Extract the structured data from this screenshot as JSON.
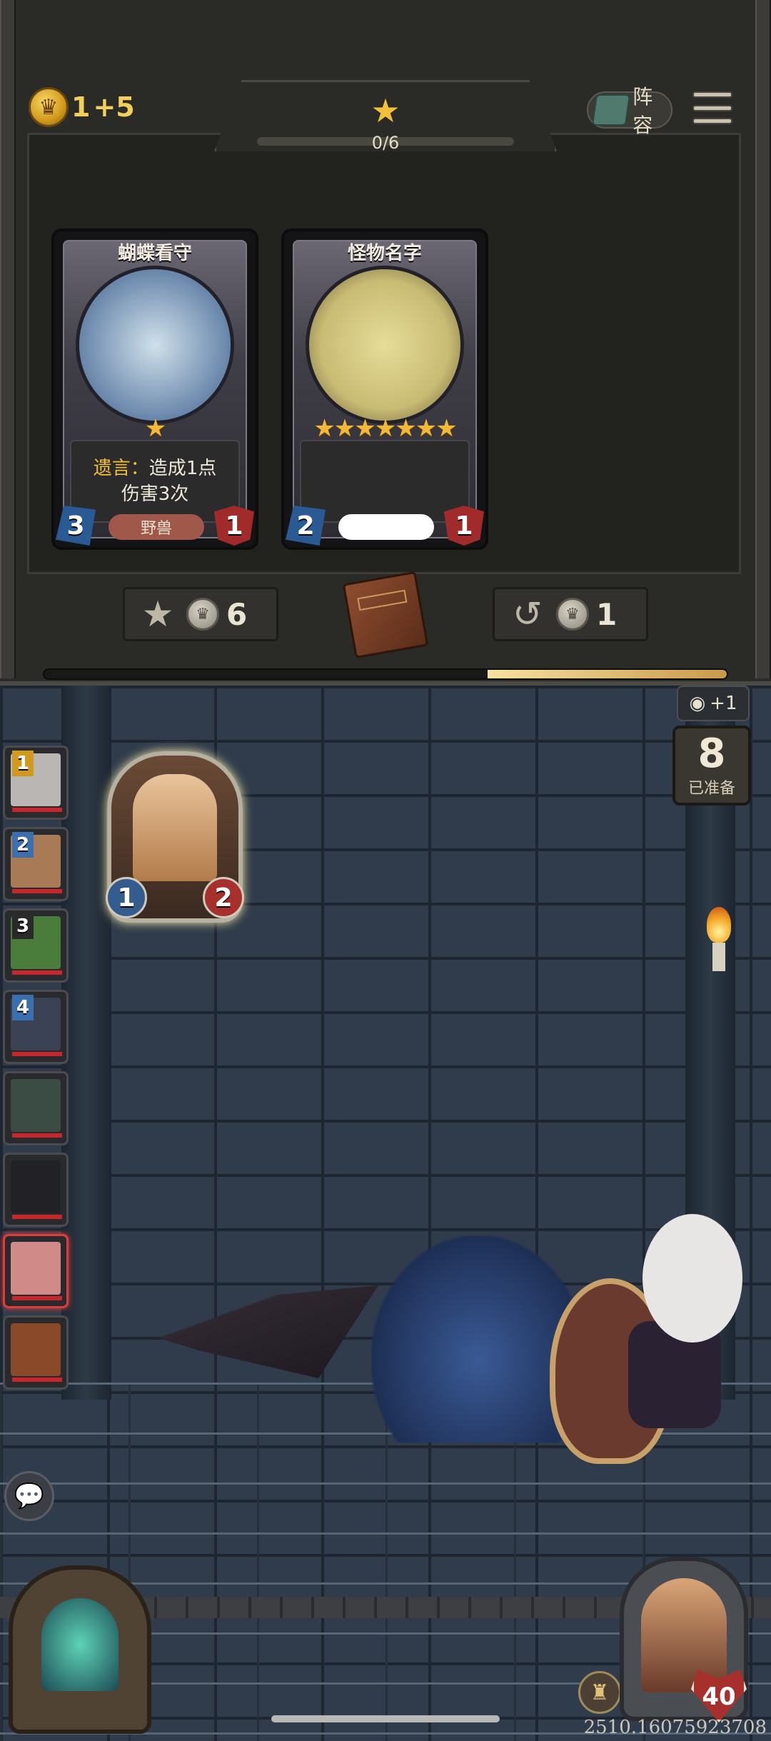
{
  "header": {
    "gold_amount": "1",
    "gold_income": "+5",
    "star_progress": "0/6",
    "lineup_label": "阵容"
  },
  "shop": {
    "cards": [
      {
        "name": "蝴蝶看守",
        "stars": "★",
        "ability_keyword": "遗言：",
        "ability_text_1": "造成1点",
        "ability_text_2": "伤害3次",
        "attack": "3",
        "health": "1",
        "tribe": "野兽",
        "tribe_color": "#a0584a",
        "portrait_color": "#3c5f8f"
      },
      {
        "name": "怪物名字",
        "stars": "★★★★★★★",
        "ability_keyword": "",
        "ability_text_1": "",
        "ability_text_2": "",
        "attack": "2",
        "health": "1",
        "tribe": "",
        "tribe_color": "#ffffff",
        "portrait_color": "#c8bb74"
      }
    ],
    "upgrade_cost": "6",
    "refresh_cost": "1",
    "timer_fraction": 0.35
  },
  "battlefield": {
    "vision_bonus": "+1",
    "ready_count": "8",
    "ready_label": "已准备",
    "minion": {
      "attack": "1",
      "health": "2"
    },
    "units": [
      {
        "num": "1",
        "num_color": "#d19a1c",
        "face_color": "#b9b6b4"
      },
      {
        "num": "2",
        "num_color": "#3a6fb0",
        "face_color": "#a87a55"
      },
      {
        "num": "3",
        "num_color": "#2a2a2a",
        "face_color": "#4a7d3c"
      },
      {
        "num": "4",
        "num_color": "#3a6fb0",
        "face_color": "#3b4253"
      },
      {
        "num": "",
        "num_color": "",
        "face_color": "#3b4c45"
      },
      {
        "num": "",
        "num_color": "",
        "face_color": "#222226"
      },
      {
        "num": "",
        "num_color": "",
        "face_color": "#d08a88",
        "selected": true
      },
      {
        "num": "",
        "num_color": "",
        "face_color": "#8a4a2a"
      }
    ]
  },
  "hero": {
    "health": "40"
  },
  "footer": {
    "version": "2510.16075923708"
  },
  "colors": {
    "gold": "#f2cf5a",
    "star": "#f2b83a",
    "attack_blue": "#2a5a93",
    "health_red": "#a12a2a"
  }
}
